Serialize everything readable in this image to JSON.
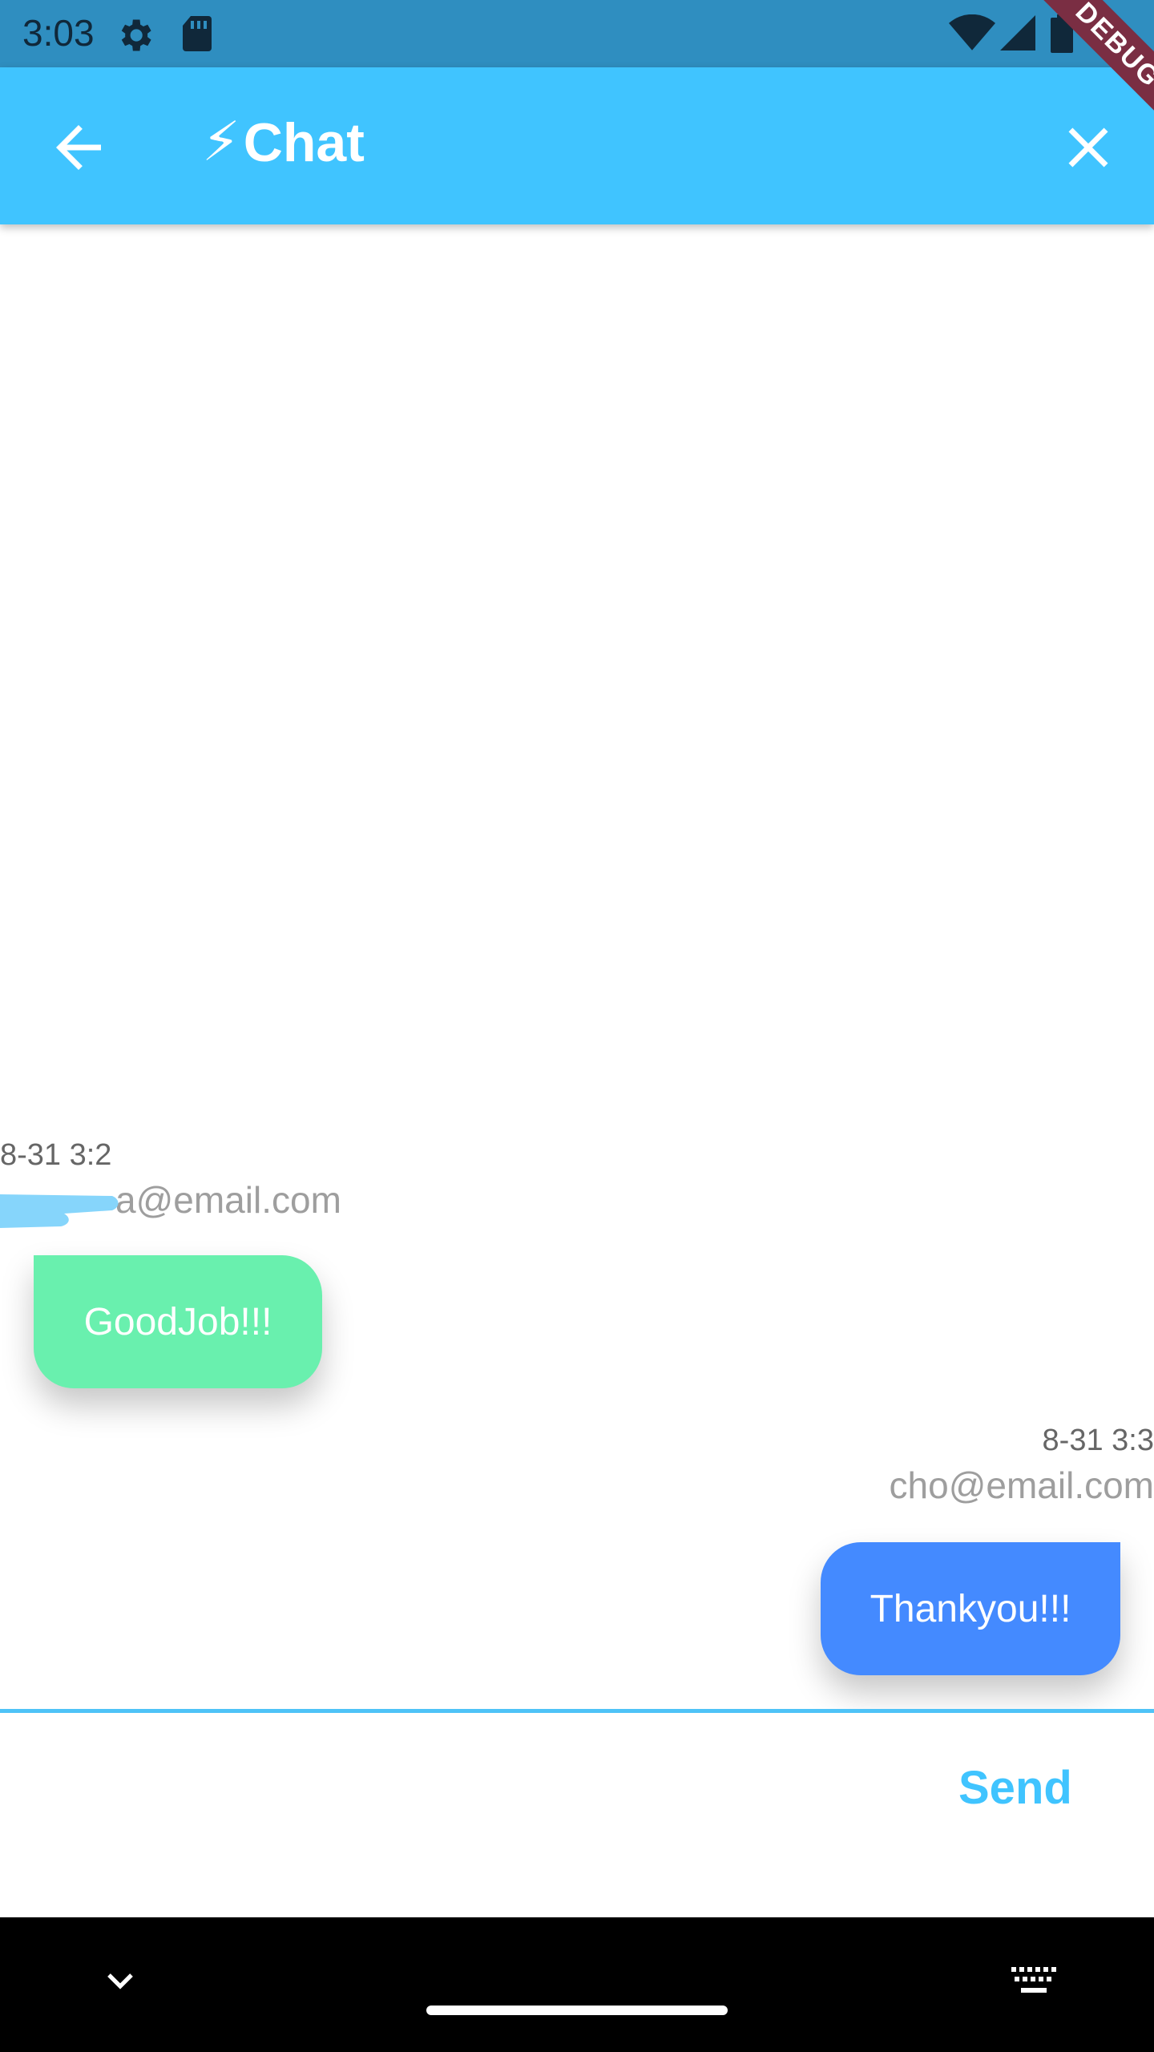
{
  "status_bar": {
    "time": "3:03",
    "icons_left": [
      "settings-gear-icon",
      "sd-card-icon"
    ],
    "icons_right": [
      "wifi-icon",
      "signal-icon",
      "battery-icon"
    ],
    "background": "#2f8ec0"
  },
  "debug_banner": "DEBUG",
  "app_bar": {
    "title_emoji": "⚡",
    "title": "Chat",
    "background": "#40c4ff"
  },
  "messages": [
    {
      "timestamp": "8-31 3:2",
      "sender": "a@email.com",
      "text": "GoodJob!!!",
      "bubble_color": "#69f0ae"
    },
    {
      "timestamp": "8-31 3:3",
      "sender": "cho@email.com",
      "text": "Thankyou!!!",
      "bubble_color": "#448aff"
    }
  ],
  "composer": {
    "input_value": "",
    "send_label": "Send",
    "accent": "#40c4ff"
  }
}
